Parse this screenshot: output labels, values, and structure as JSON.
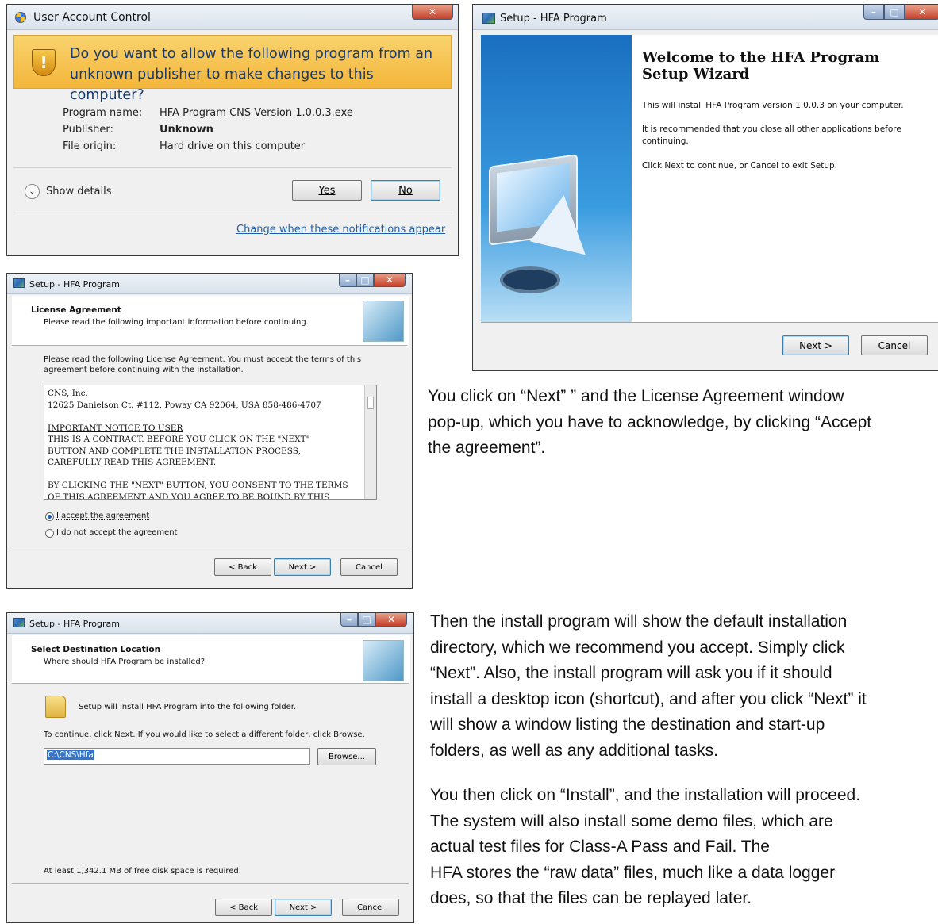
{
  "uac": {
    "title": "User Account Control",
    "question": [
      "Do you want to allow the following program from an",
      "unknown publisher to make changes to this computer?"
    ],
    "program_label": "Program name:",
    "program_value": "HFA Program CNS Version 1.0.0.3.exe",
    "publisher_label": "Publisher:",
    "publisher_value": "Unknown",
    "origin_label": "File origin:",
    "origin_value": "Hard drive on this computer",
    "show_details": "Show details",
    "yes": "Yes",
    "no": "No",
    "change_link": "Change when these notifications appear"
  },
  "welcome": {
    "title": "Setup - HFA Program",
    "heading": [
      "Welcome to the HFA Program",
      "Setup Wizard"
    ],
    "line1": "This will install HFA Program version 1.0.0.3 on your computer.",
    "line2a": "It is recommended that you close all other applications before",
    "line2b": "continuing.",
    "line3": "Click Next to continue, or Cancel to exit Setup.",
    "next": "Next >",
    "cancel": "Cancel"
  },
  "license": {
    "title": "Setup - HFA Program",
    "heading": "License Agreement",
    "subheading": "Please read the following important information before continuing.",
    "intro_a": "Please read the following License Agreement. You must accept the terms of this",
    "intro_b": "agreement before continuing with the installation.",
    "text": [
      "CNS, Inc.",
      "12625 Danielson Ct. #112, Poway CA 92064, USA 858-486-4707",
      "",
      "IMPORTANT NOTICE TO USER",
      "THIS IS A CONTRACT.  BEFORE YOU CLICK ON THE \"NEXT\"",
      "BUTTON AND COMPLETE THE INSTALLATION PROCESS,",
      "CAREFULLY READ THIS AGREEMENT.",
      "",
      "BY CLICKING THE \"NEXT\" BUTTON, YOU CONSENT TO THE TERMS",
      "OF THIS AGREEMENT AND YOU AGREE TO BE BOUND BY THIS"
    ],
    "accept": "I accept the agreement",
    "decline": "I do not accept the agreement",
    "back": "< Back",
    "next": "Next >",
    "cancel": "Cancel"
  },
  "destination": {
    "title": "Setup - HFA Program",
    "heading": "Select Destination Location",
    "subheading": "Where should HFA Program be installed?",
    "folder_text": "Setup will install HFA Program into the following folder.",
    "instruction": "To continue, click Next. If you would like to select a different folder, click Browse.",
    "path": "C:\\CNS\\Hfa",
    "browse": "Browse...",
    "space": "At least 1,342.1 MB of free disk space is required.",
    "back": "< Back",
    "next": "Next >",
    "cancel": "Cancel"
  },
  "text1": [
    "You click on “Next” ” and the License Agreement window",
    "pop-up, which you have to acknowledge, by clicking “Accept",
    "the agreement”."
  ],
  "text2": [
    "Then the install program will show the default installation",
    "directory, which we recommend you accept. Simply click",
    "“Next”. Also, the install program will ask you if it should",
    "install a desktop icon (shortcut), and after you click “Next” it",
    "will show a window listing the destination and start-up",
    "folders, as well as any additional tasks."
  ],
  "text3": [
    "You then click on “Install”, and the installation will proceed.",
    "The system will also install some demo files, which are",
    "actual test files for Class-A Pass and Fail. The",
    "HFA stores the “raw data” files, much like a data logger",
    "does, so that the files can be replayed later."
  ]
}
